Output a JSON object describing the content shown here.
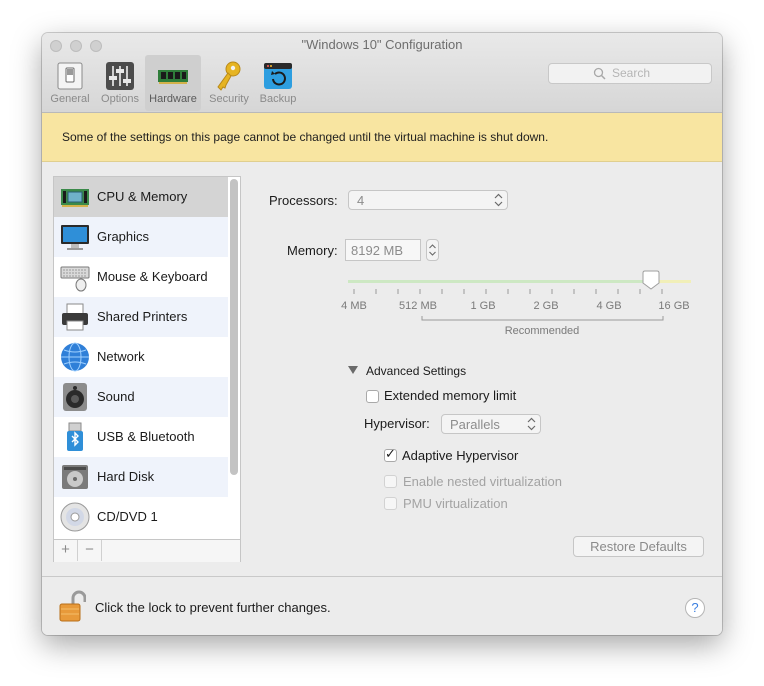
{
  "window": {
    "title": "\"Windows 10\" Configuration"
  },
  "toolbar": {
    "items": [
      {
        "label": "General",
        "icon": "general-switch-icon"
      },
      {
        "label": "Options",
        "icon": "options-sliders-icon"
      },
      {
        "label": "Hardware",
        "icon": "hardware-ram-icon",
        "selected": true
      },
      {
        "label": "Security",
        "icon": "key-icon"
      },
      {
        "label": "Backup",
        "icon": "backup-icon"
      }
    ],
    "search_placeholder": "Search"
  },
  "notice": "Some of the settings on this page cannot be changed until the virtual machine is shut down.",
  "sidebar": {
    "items": [
      {
        "label": "CPU & Memory",
        "icon": "cpu-memory-icon",
        "selected": true
      },
      {
        "label": "Graphics",
        "icon": "monitor-icon"
      },
      {
        "label": "Mouse & Keyboard",
        "icon": "keyboard-icon"
      },
      {
        "label": "Shared Printers",
        "icon": "printer-icon"
      },
      {
        "label": "Network",
        "icon": "globe-icon"
      },
      {
        "label": "Sound",
        "icon": "speaker-icon"
      },
      {
        "label": "USB & Bluetooth",
        "icon": "usb-icon"
      },
      {
        "label": "Hard Disk",
        "icon": "hard-disk-icon"
      },
      {
        "label": "CD/DVD 1",
        "icon": "cd-icon"
      }
    ],
    "add_label": "+",
    "remove_label": "−"
  },
  "settings": {
    "processors_label": "Processors:",
    "processors_value": "4",
    "memory_label": "Memory:",
    "memory_value": "8192 MB",
    "slider": {
      "ticks": [
        "4 MB",
        "512 MB",
        "1 GB",
        "2 GB",
        "4 GB",
        "16 GB"
      ],
      "recommended_label": "Recommended",
      "value": "8192 MB"
    },
    "advanced_label": "Advanced Settings",
    "extended_memory_label": "Extended memory limit",
    "extended_memory_checked": false,
    "hypervisor_label": "Hypervisor:",
    "hypervisor_value": "Parallels",
    "adaptive_hypervisor_label": "Adaptive Hypervisor",
    "adaptive_hypervisor_checked": true,
    "nested_virtualization_label": "Enable nested virtualization",
    "pmu_virtualization_label": "PMU virtualization",
    "restore_defaults_label": "Restore Defaults"
  },
  "footer": {
    "lock_text": "Click the lock to prevent further changes.",
    "help_label": "?"
  },
  "colors": {
    "notice_bg": "#f8e5a1",
    "selected_row": "#d4d4d4",
    "alt_row": "#eff3fb",
    "help_accent": "#3b7fe0"
  }
}
